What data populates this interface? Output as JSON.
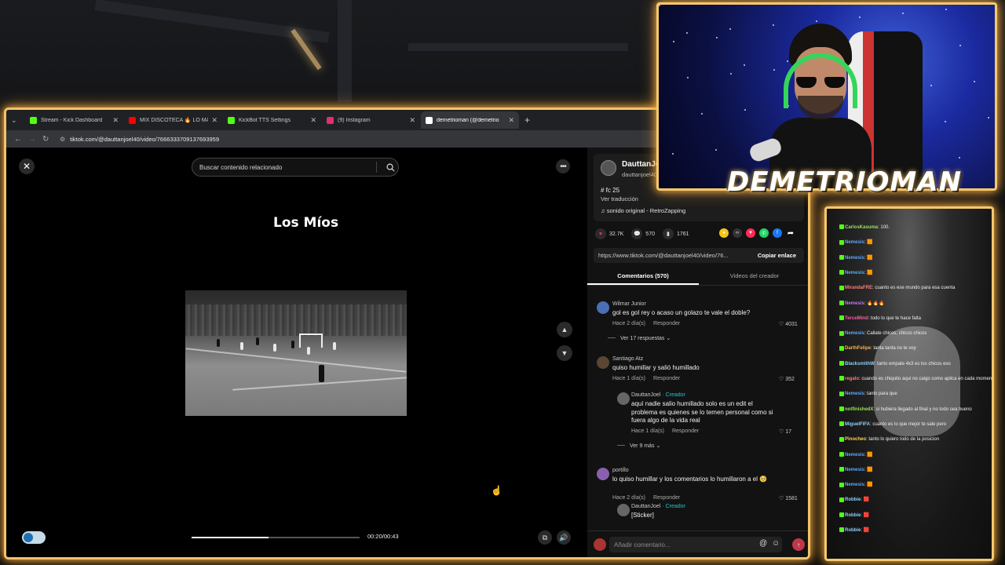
{
  "browser": {
    "tabs": [
      {
        "title": "Stream - Kick Dashboard",
        "icon": "kick-icon",
        "color": "#53fc18",
        "active": false
      },
      {
        "title": "MIX DISCOTECA 🔥 LO MAS N",
        "icon": "youtube-icon",
        "color": "#ff0000",
        "active": false
      },
      {
        "title": "KickBot TTS Settings",
        "icon": "kickbot-icon",
        "color": "#53fc18",
        "active": false
      },
      {
        "title": "(9) Instagram",
        "icon": "instagram-icon",
        "color": "#e1306c",
        "active": false
      },
      {
        "title": "demetrioman (@demetrio",
        "icon": "tiktok-icon",
        "color": "#ffffff",
        "active": true
      }
    ],
    "new_tab": "+",
    "url": "tiktok.com/@dauttanjoel40/video/7666333709137693959"
  },
  "video": {
    "search_placeholder": "Buscar contenido relacionado",
    "title": "Los Míos",
    "time": "00:20/00:43",
    "progress": 0.46
  },
  "post": {
    "author_name": "DauttanJo",
    "author_handle": "dauttanjoel40",
    "hashtag": "# fc 25",
    "translate": "Ver traducción",
    "sound": "♫  sonido original - RetroZapping",
    "likes": "32.7K",
    "comments": "570",
    "saves": "1761",
    "share_url": "https://www.tiktok.com/@dauttanjoel40/video/76...",
    "copy_label": "Copiar enlace",
    "tab_comments": "Comentarios (570)",
    "tab_videos": "Videos del creador",
    "comment_placeholder": "Añadir comentario..."
  },
  "comments": [
    {
      "name": "Wilmar Junior",
      "text": "gol es gol rey o acaso un golazo te vale el doble?",
      "time": "Hace 2 día(s)",
      "reply": "Responder",
      "likes": "4031",
      "more": "Ver 17 respuestas ⌄"
    },
    {
      "name": "Santiago Atz",
      "text": "quiso humillar y salió humillado",
      "time": "Hace 1 día(s)",
      "reply": "Responder",
      "likes": "352"
    },
    {
      "name": "DauttanJoel",
      "creator": " · Creador",
      "text": "aquí nadie salio humillado solo es un edit el problema es quienes se lo temen personal como si fuera algo de la vida real",
      "time": "Hace 1 día(s)",
      "reply": "Responder",
      "likes": "17",
      "more": "Ver 9 más ⌄"
    },
    {
      "name": "portillo",
      "text": "lo quiso humillar y los comentarios lo humillaron a el 🥺",
      "time": "Hace 2 día(s)",
      "reply": "Responder",
      "likes": "1581"
    },
    {
      "name": "DauttanJoel",
      "creator": " · Creador",
      "text": "[Sticker]"
    }
  ],
  "streamer": {
    "name": "DEMETRIOMAN"
  },
  "chat": [
    {
      "user": "CarlosKasuma",
      "msg": ": 100.",
      "color": "#9be15d"
    },
    {
      "user": "Nemesis",
      "msg": ": 🟧",
      "color": "#5aa9ff"
    },
    {
      "user": "Nemesis",
      "msg": ": 🟧",
      "color": "#5aa9ff"
    },
    {
      "user": "Nemesis",
      "msg": ": 🟧",
      "color": "#5aa9ff"
    },
    {
      "user": "MirandaFRE",
      "msg": ": cuanto es ese mundo para esa cuenta",
      "color": "#ff7a7a"
    },
    {
      "user": "Nemesis",
      "msg": ": 🔥🔥🔥",
      "color": "#c078ff"
    },
    {
      "user": "TerceMind",
      "msg": ": todo lo que te hace falta",
      "color": "#ff5aa5"
    },
    {
      "user": "Nemesis",
      "msg": ": Callate chicos, chicos chicos",
      "color": "#5aa9ff"
    },
    {
      "user": "DarthFelipe",
      "msg": ": tanta tanta no te voy",
      "color": "#ffb04a"
    },
    {
      "user": "BlacksmithW",
      "msg": ": tanto empate 4x3 es los chicos eso",
      "color": "#8ad0ff"
    },
    {
      "user": "regalo",
      "msg": ": cuando es chiquito aqui no caigo como aplica en cada momento",
      "color": "#ff7a7a"
    },
    {
      "user": "Nemesis",
      "msg": ": tanto para que",
      "color": "#5aa9ff"
    },
    {
      "user": "notfinishedX",
      "msg": ": si hubiera llegado al final y no todo sea bueno",
      "color": "#9be15d"
    },
    {
      "user": "MiguelFIFA",
      "msg": ": cuanto es lo que mejor te sale pero",
      "color": "#8ad0ff"
    },
    {
      "user": "Pinocheo",
      "msg": ": tanto lo quiero todo de la posicion",
      "color": "#ffd24a"
    },
    {
      "user": "Nemesis",
      "msg": ": 🟧",
      "color": "#5aa9ff"
    },
    {
      "user": "Nemesis",
      "msg": ": 🟧",
      "color": "#5aa9ff"
    },
    {
      "user": "Nemesis",
      "msg": ": 🟧",
      "color": "#5aa9ff"
    },
    {
      "user": "Robbie",
      "msg": ": 🟥",
      "color": "#8ad0ff"
    },
    {
      "user": "Robbie",
      "msg": ": 🟥",
      "color": "#8ad0ff"
    },
    {
      "user": "Robbie",
      "msg": ": 🟥",
      "color": "#8ad0ff"
    }
  ]
}
